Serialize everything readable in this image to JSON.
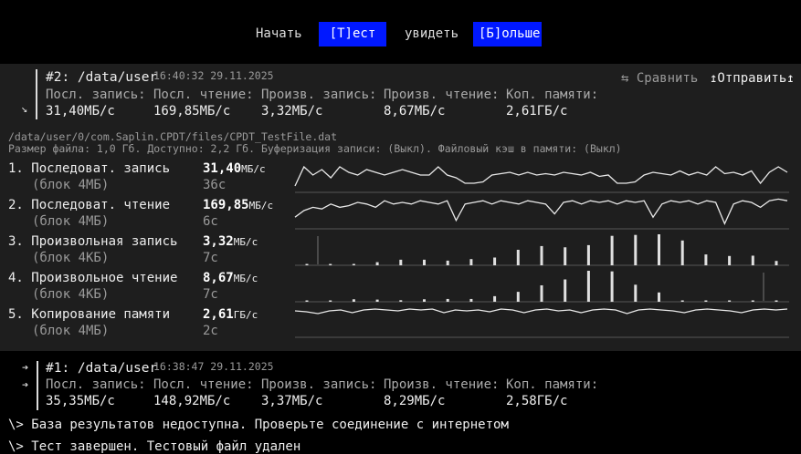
{
  "menu": [
    "Начать",
    "[Т]ест",
    "увидеть",
    "[Б]ольше"
  ],
  "current": {
    "title": "#2: /data/user",
    "time": "16:40:32 29.11.2025",
    "arrow": "↘",
    "compare": "⇆ Сравнить",
    "send": "↥Отправить↥",
    "headers": [
      "Посл. запись:",
      "Посл. чтение:",
      "Произв. запись:",
      "Произв. чтение:",
      "Коп. памяти:"
    ],
    "values": [
      "31,40МБ/с",
      "169,85МБ/с",
      "3,32МБ/с",
      "8,67МБ/с",
      "2,61ГБ/с"
    ],
    "path": "/data/user/0/com.Saplin.CPDT/files/CPDT_TestFile.dat",
    "info": "Размер файла: 1,0 Гб. Доступно: 2,2 Гб. Буферизация записи: (Выкл). Файловый кэш в памяти: (Выкл)",
    "tests": [
      {
        "name": "1. Последоват. запись",
        "block": "(блок 4МБ)",
        "value": "31,40",
        "unit": "МБ/с",
        "time": "36с"
      },
      {
        "name": "2. Последоват. чтение",
        "block": "(блок 4МБ)",
        "value": "169,85",
        "unit": "МБ/с",
        "time": "6с"
      },
      {
        "name": "3. Произвольная запись",
        "block": "(блок 4КБ)",
        "value": "3,32",
        "unit": "МБ/с",
        "time": "7с"
      },
      {
        "name": "4. Произвольное чтение",
        "block": "(блок 4КБ)",
        "value": "8,67",
        "unit": "МБ/с",
        "time": "7с"
      },
      {
        "name": "5. Копирование памяти",
        "block": "(блок 4МБ)",
        "value": "2,61",
        "unit": "ГБ/с",
        "time": "2с"
      }
    ]
  },
  "previous": {
    "arrows": [
      "➔",
      "➔"
    ],
    "title": "#1: /data/user",
    "time": "16:38:47 29.11.2025",
    "headers": [
      "Посл. запись:",
      "Посл. чтение:",
      "Произв. запись:",
      "Произв. чтение:",
      "Коп. памяти:"
    ],
    "values": [
      "35,35МБ/с",
      "148,92МБ/с",
      "3,37МБ/с",
      "8,29МБ/с",
      "2,58ГБ/с"
    ]
  },
  "log": [
    "\\> База результатов недоступна. Проверьте соединение с интернетом",
    "\\> Тест завершен. Тестовый файл удален"
  ],
  "chart_data": {
    "type": "line",
    "seq_write": [
      0.2,
      0.9,
      0.6,
      0.8,
      0.5,
      0.9,
      0.7,
      0.6,
      0.8,
      0.7,
      0.6,
      0.7,
      0.8,
      0.7,
      0.6,
      0.6,
      0.9,
      0.6,
      0.5,
      0.3,
      0.3,
      0.35,
      0.6,
      0.65,
      0.7,
      0.6,
      0.7,
      0.6,
      0.65,
      0.6,
      0.7,
      0.65,
      0.6,
      0.7,
      0.55,
      0.6,
      0.3,
      0.3,
      0.35,
      0.6,
      0.7,
      0.65,
      0.6,
      0.75,
      0.6,
      0.7,
      0.6,
      0.9,
      0.65,
      0.7,
      0.6,
      0.75,
      0.3,
      0.7,
      0.9,
      0.7
    ],
    "seq_read": [
      0.3,
      0.5,
      0.6,
      0.55,
      0.7,
      0.6,
      0.65,
      0.75,
      0.7,
      0.6,
      0.8,
      0.7,
      0.75,
      0.7,
      0.8,
      0.75,
      0.7,
      0.8,
      0.2,
      0.7,
      0.75,
      0.8,
      0.7,
      0.8,
      0.75,
      0.7,
      0.8,
      0.75,
      0.7,
      0.4,
      0.75,
      0.8,
      0.7,
      0.8,
      0.75,
      0.8,
      0.7,
      0.8,
      0.75,
      0.8,
      0.3,
      0.7,
      0.8,
      0.75,
      0.8,
      0.7,
      0.8,
      0.75,
      0.1,
      0.7,
      0.8,
      0.75,
      0.6,
      0.8,
      0.85,
      0.8
    ],
    "rand_write": [
      0.04,
      0.04,
      0.03,
      0.1,
      0.18,
      0.18,
      0.15,
      0.2,
      0.25,
      0.5,
      0.62,
      0.58,
      0.65,
      0.95,
      0.98,
      1.0,
      0.8,
      0.35,
      0.3,
      0.31,
      0.14
    ],
    "rand_read": [
      0.02,
      0.04,
      0.08,
      0.07,
      0.05,
      0.08,
      0.09,
      0.09,
      0.18,
      0.32,
      0.53,
      0.72,
      1.0,
      0.98,
      0.55,
      0.3,
      0.02,
      0.02,
      0.02,
      0.02,
      0.02
    ],
    "mem_copy": [
      0.5,
      0.4,
      0.2,
      0.5,
      0.6,
      0.3,
      0.6,
      0.7,
      0.6,
      0.5,
      0.7,
      0.6,
      0.7,
      0.3,
      0.6,
      0.5,
      0.6,
      0.4,
      0.7,
      0.6,
      0.3,
      0.6,
      0.7,
      0.5,
      0.6,
      0.3,
      0.6,
      0.7,
      0.6,
      0.2,
      0.6,
      0.7,
      0.6,
      0.5,
      0.3,
      0.6,
      0.7,
      0.6,
      0.5,
      0.3,
      0.6,
      0.7,
      0.6,
      0.7
    ]
  }
}
